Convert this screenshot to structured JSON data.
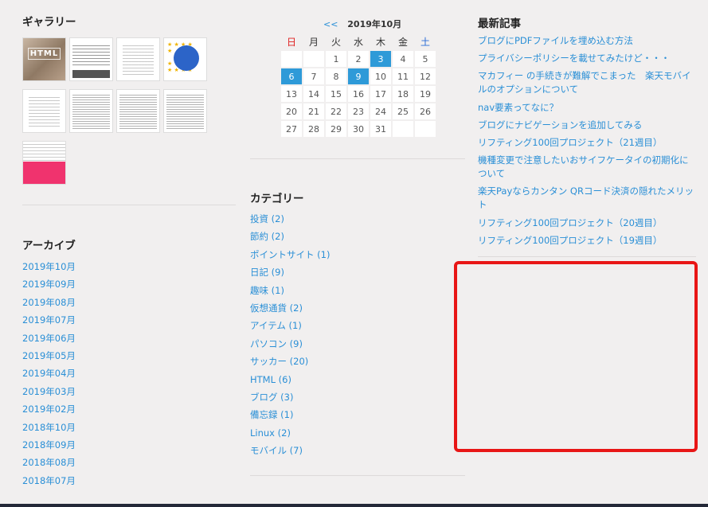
{
  "gallery": {
    "title": "ギャラリー",
    "thumbs": [
      "HTML"
    ]
  },
  "archive": {
    "title": "アーカイブ",
    "items": [
      "2019年10月",
      "2019年09月",
      "2019年08月",
      "2019年07月",
      "2019年06月",
      "2019年05月",
      "2019年04月",
      "2019年03月",
      "2019年02月",
      "2018年10月",
      "2018年09月",
      "2018年08月",
      "2018年07月"
    ]
  },
  "calendar": {
    "prev": "<<",
    "month": "2019年10月",
    "weekdays": [
      "日",
      "月",
      "火",
      "水",
      "木",
      "金",
      "土"
    ],
    "rows": [
      [
        "",
        "",
        "1",
        "2",
        "3",
        "4",
        "5"
      ],
      [
        "6",
        "7",
        "8",
        "9",
        "10",
        "11",
        "12"
      ],
      [
        "13",
        "14",
        "15",
        "16",
        "17",
        "18",
        "19"
      ],
      [
        "20",
        "21",
        "22",
        "23",
        "24",
        "25",
        "26"
      ],
      [
        "27",
        "28",
        "29",
        "30",
        "31",
        "",
        ""
      ]
    ],
    "highlighted_days": [
      "3",
      "6",
      "9"
    ]
  },
  "category": {
    "title": "カテゴリー",
    "items": [
      {
        "name": "投資",
        "count": "(2)"
      },
      {
        "name": "節約",
        "count": "(2)"
      },
      {
        "name": "ポイントサイト",
        "count": "(1)"
      },
      {
        "name": "日記",
        "count": "(9)"
      },
      {
        "name": "趣味",
        "count": "(1)"
      },
      {
        "name": "仮想通貨",
        "count": "(2)"
      },
      {
        "name": "アイテム",
        "count": "(1)"
      },
      {
        "name": "パソコン",
        "count": "(9)"
      },
      {
        "name": "サッカー",
        "count": "(20)"
      },
      {
        "name": "HTML",
        "count": "(6)"
      },
      {
        "name": "ブログ",
        "count": "(3)"
      },
      {
        "name": "備忘録",
        "count": "(1)"
      },
      {
        "name": "Linux",
        "count": "(2)"
      },
      {
        "name": "モバイル",
        "count": "(7)"
      }
    ]
  },
  "recent": {
    "title": "最新記事",
    "items": [
      "ブログにPDFファイルを埋め込む方法",
      "プライバシーポリシーを載せてみたけど・・・",
      "マカフィー の手続きが難解でこまった　楽天モバイルのオプションについて",
      "nav要素ってなに？",
      "ブログにナビゲーションを追加してみる",
      "リフティング100回プロジェクト（21週目）",
      "機種変更で注意したいおサイフケータイの初期化について",
      "楽天Payならカンタン QRコード決済の隠れたメリット",
      "リフティング100回プロジェクト（20週目）",
      "リフティング100回プロジェクト（19週目）"
    ]
  },
  "colors": {
    "link": "#2a8fd6",
    "calendar_selected": "#2e9ad8",
    "highlight_border": "#e81616",
    "background": "#f1efef"
  }
}
